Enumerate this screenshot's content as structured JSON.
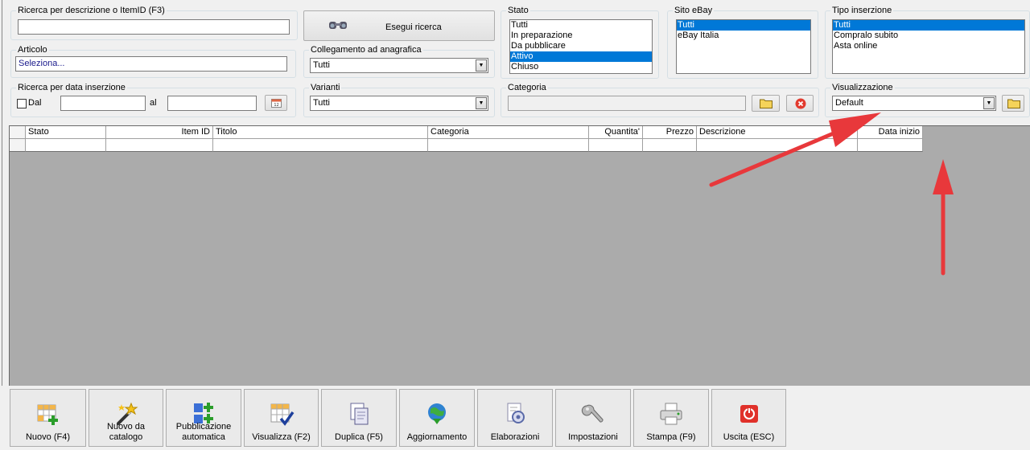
{
  "search": {
    "desc_label": "Ricerca per descrizione o ItemID (F3)",
    "desc_value": "",
    "run_label": "Esegui ricerca"
  },
  "articolo": {
    "label": "Articolo",
    "value": "Seleziona..."
  },
  "collegamento": {
    "label": "Collegamento ad anagrafica",
    "value": "Tutti"
  },
  "data_ins": {
    "label": "Ricerca per data inserzione",
    "dal_label": "Dal",
    "al_label": "al",
    "dal_value": "",
    "al_value": ""
  },
  "varianti": {
    "label": "Varianti",
    "value": "Tutti"
  },
  "stato": {
    "label": "Stato",
    "items": [
      "Tutti",
      "In preparazione",
      "Da pubblicare",
      "Attivo",
      "Chiuso"
    ],
    "selected": "Attivo"
  },
  "sito": {
    "label": "Sito eBay",
    "items": [
      "Tutti",
      "eBay Italia"
    ],
    "selected": "Tutti"
  },
  "tipo": {
    "label": "Tipo inserzione",
    "items": [
      "Tutti",
      "Compralo subito",
      "Asta online"
    ],
    "selected": "Tutti"
  },
  "categoria": {
    "label": "Categoria",
    "value": ""
  },
  "visualizzazione": {
    "label": "Visualizzazione",
    "value": "Default"
  },
  "grid": {
    "columns": [
      "Stato",
      "Item ID",
      "Titolo",
      "Categoria",
      "Quantita'",
      "Prezzo",
      "Descrizione",
      "Data inizio"
    ]
  },
  "toolbar": [
    {
      "label": "Nuovo (F4)",
      "icon": "grid-add-icon"
    },
    {
      "label": "Nuovo da\ncatalogo",
      "icon": "magic-wand-icon"
    },
    {
      "label": "Pubblicazione\nautomatica",
      "icon": "publish-icon"
    },
    {
      "label": "Visualizza (F2)",
      "icon": "grid-check-icon"
    },
    {
      "label": "Duplica (F5)",
      "icon": "duplicate-icon"
    },
    {
      "label": "Aggiornamento",
      "icon": "globe-update-icon"
    },
    {
      "label": "Elaborazioni",
      "icon": "processing-icon"
    },
    {
      "label": "Impostazioni",
      "icon": "wrench-icon"
    },
    {
      "label": "Stampa (F9)",
      "icon": "printer-icon"
    },
    {
      "label": "Uscita (ESC)",
      "icon": "power-icon"
    }
  ],
  "colors": {
    "selection": "#0078d7",
    "grid_bg": "#ababab",
    "annotation_arrow": "#e8383b"
  }
}
